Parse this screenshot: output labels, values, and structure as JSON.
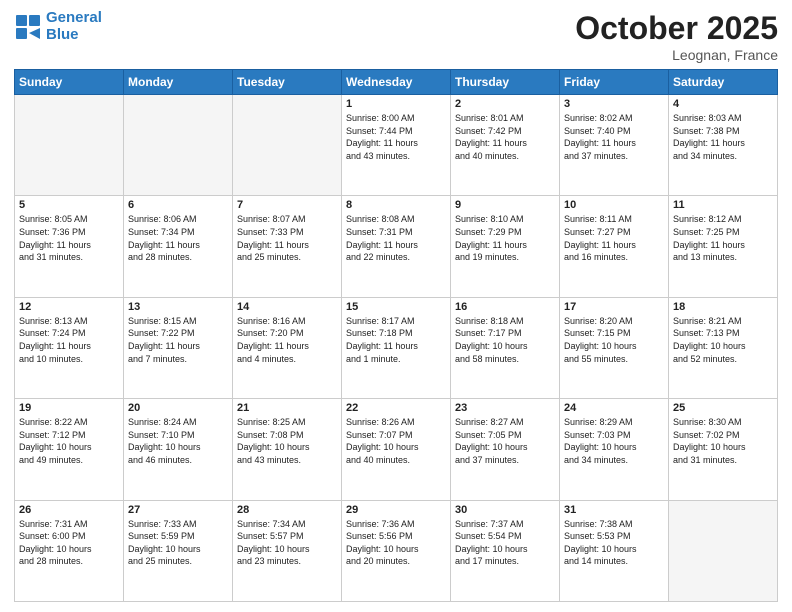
{
  "header": {
    "logo_line1": "General",
    "logo_line2": "Blue",
    "month": "October 2025",
    "location": "Leognan, France"
  },
  "weekdays": [
    "Sunday",
    "Monday",
    "Tuesday",
    "Wednesday",
    "Thursday",
    "Friday",
    "Saturday"
  ],
  "weeks": [
    [
      {
        "day": "",
        "info": ""
      },
      {
        "day": "",
        "info": ""
      },
      {
        "day": "",
        "info": ""
      },
      {
        "day": "1",
        "info": "Sunrise: 8:00 AM\nSunset: 7:44 PM\nDaylight: 11 hours\nand 43 minutes."
      },
      {
        "day": "2",
        "info": "Sunrise: 8:01 AM\nSunset: 7:42 PM\nDaylight: 11 hours\nand 40 minutes."
      },
      {
        "day": "3",
        "info": "Sunrise: 8:02 AM\nSunset: 7:40 PM\nDaylight: 11 hours\nand 37 minutes."
      },
      {
        "day": "4",
        "info": "Sunrise: 8:03 AM\nSunset: 7:38 PM\nDaylight: 11 hours\nand 34 minutes."
      }
    ],
    [
      {
        "day": "5",
        "info": "Sunrise: 8:05 AM\nSunset: 7:36 PM\nDaylight: 11 hours\nand 31 minutes."
      },
      {
        "day": "6",
        "info": "Sunrise: 8:06 AM\nSunset: 7:34 PM\nDaylight: 11 hours\nand 28 minutes."
      },
      {
        "day": "7",
        "info": "Sunrise: 8:07 AM\nSunset: 7:33 PM\nDaylight: 11 hours\nand 25 minutes."
      },
      {
        "day": "8",
        "info": "Sunrise: 8:08 AM\nSunset: 7:31 PM\nDaylight: 11 hours\nand 22 minutes."
      },
      {
        "day": "9",
        "info": "Sunrise: 8:10 AM\nSunset: 7:29 PM\nDaylight: 11 hours\nand 19 minutes."
      },
      {
        "day": "10",
        "info": "Sunrise: 8:11 AM\nSunset: 7:27 PM\nDaylight: 11 hours\nand 16 minutes."
      },
      {
        "day": "11",
        "info": "Sunrise: 8:12 AM\nSunset: 7:25 PM\nDaylight: 11 hours\nand 13 minutes."
      }
    ],
    [
      {
        "day": "12",
        "info": "Sunrise: 8:13 AM\nSunset: 7:24 PM\nDaylight: 11 hours\nand 10 minutes."
      },
      {
        "day": "13",
        "info": "Sunrise: 8:15 AM\nSunset: 7:22 PM\nDaylight: 11 hours\nand 7 minutes."
      },
      {
        "day": "14",
        "info": "Sunrise: 8:16 AM\nSunset: 7:20 PM\nDaylight: 11 hours\nand 4 minutes."
      },
      {
        "day": "15",
        "info": "Sunrise: 8:17 AM\nSunset: 7:18 PM\nDaylight: 11 hours\nand 1 minute."
      },
      {
        "day": "16",
        "info": "Sunrise: 8:18 AM\nSunset: 7:17 PM\nDaylight: 10 hours\nand 58 minutes."
      },
      {
        "day": "17",
        "info": "Sunrise: 8:20 AM\nSunset: 7:15 PM\nDaylight: 10 hours\nand 55 minutes."
      },
      {
        "day": "18",
        "info": "Sunrise: 8:21 AM\nSunset: 7:13 PM\nDaylight: 10 hours\nand 52 minutes."
      }
    ],
    [
      {
        "day": "19",
        "info": "Sunrise: 8:22 AM\nSunset: 7:12 PM\nDaylight: 10 hours\nand 49 minutes."
      },
      {
        "day": "20",
        "info": "Sunrise: 8:24 AM\nSunset: 7:10 PM\nDaylight: 10 hours\nand 46 minutes."
      },
      {
        "day": "21",
        "info": "Sunrise: 8:25 AM\nSunset: 7:08 PM\nDaylight: 10 hours\nand 43 minutes."
      },
      {
        "day": "22",
        "info": "Sunrise: 8:26 AM\nSunset: 7:07 PM\nDaylight: 10 hours\nand 40 minutes."
      },
      {
        "day": "23",
        "info": "Sunrise: 8:27 AM\nSunset: 7:05 PM\nDaylight: 10 hours\nand 37 minutes."
      },
      {
        "day": "24",
        "info": "Sunrise: 8:29 AM\nSunset: 7:03 PM\nDaylight: 10 hours\nand 34 minutes."
      },
      {
        "day": "25",
        "info": "Sunrise: 8:30 AM\nSunset: 7:02 PM\nDaylight: 10 hours\nand 31 minutes."
      }
    ],
    [
      {
        "day": "26",
        "info": "Sunrise: 7:31 AM\nSunset: 6:00 PM\nDaylight: 10 hours\nand 28 minutes."
      },
      {
        "day": "27",
        "info": "Sunrise: 7:33 AM\nSunset: 5:59 PM\nDaylight: 10 hours\nand 25 minutes."
      },
      {
        "day": "28",
        "info": "Sunrise: 7:34 AM\nSunset: 5:57 PM\nDaylight: 10 hours\nand 23 minutes."
      },
      {
        "day": "29",
        "info": "Sunrise: 7:36 AM\nSunset: 5:56 PM\nDaylight: 10 hours\nand 20 minutes."
      },
      {
        "day": "30",
        "info": "Sunrise: 7:37 AM\nSunset: 5:54 PM\nDaylight: 10 hours\nand 17 minutes."
      },
      {
        "day": "31",
        "info": "Sunrise: 7:38 AM\nSunset: 5:53 PM\nDaylight: 10 hours\nand 14 minutes."
      },
      {
        "day": "",
        "info": ""
      }
    ]
  ]
}
